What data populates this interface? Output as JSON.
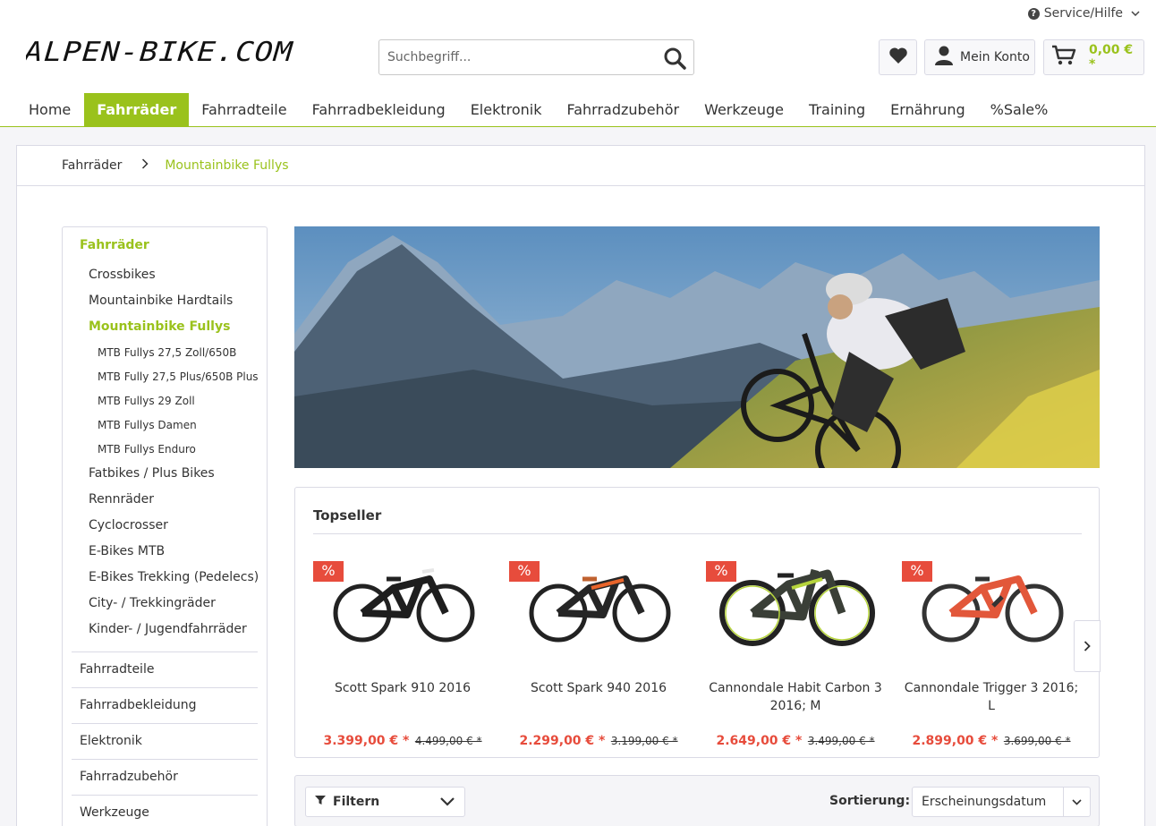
{
  "header": {
    "service_label": "Service/Hilfe",
    "logo_text": "ALPEN-BIKE.COM",
    "search_placeholder": "Suchbegriff...",
    "account_label": "Mein Konto",
    "cart_total": "0,00 € *"
  },
  "nav": {
    "items": [
      "Home",
      "Fahrräder",
      "Fahrradteile",
      "Fahrradbekleidung",
      "Elektronik",
      "Fahrradzubehör",
      "Werkzeuge",
      "Training",
      "Ernährung",
      "%Sale%"
    ],
    "active": "Fahrräder"
  },
  "breadcrumb": {
    "items": [
      "Fahrräder",
      "Mountainbike Fullys"
    ]
  },
  "sidebar": {
    "heading": "Fahrräder",
    "items": [
      {
        "label": "Crossbikes"
      },
      {
        "label": "Mountainbike Hardtails"
      },
      {
        "label": "Mountainbike Fullys",
        "active": true
      },
      {
        "label": "MTB Fullys 27,5 Zoll/650B",
        "sub": true
      },
      {
        "label": "MTB Fully 27,5 Plus/650B Plus",
        "sub": true
      },
      {
        "label": "MTB Fullys 29 Zoll",
        "sub": true
      },
      {
        "label": "MTB Fullys Damen",
        "sub": true
      },
      {
        "label": "MTB Fullys Enduro",
        "sub": true
      },
      {
        "label": "Fatbikes / Plus Bikes"
      },
      {
        "label": "Rennräder"
      },
      {
        "label": "Cyclocrosser"
      },
      {
        "label": "E-Bikes MTB"
      },
      {
        "label": "E-Bikes Trekking (Pedelecs)"
      },
      {
        "label": "City- / Trekkingräder"
      },
      {
        "label": "Kinder- / Jugendfahrräder"
      }
    ],
    "main_categories": [
      "Fahrradteile",
      "Fahrradbekleidung",
      "Elektronik",
      "Fahrradzubehör",
      "Werkzeuge"
    ]
  },
  "topseller": {
    "title": "Topseller",
    "badge": "%",
    "products": [
      {
        "name": "Scott Spark 910 2016",
        "price": "3.399,00 € *",
        "old_price": "4.499,00 € *",
        "frame_color": "#1e1e1e",
        "accent": "#e6e6e6"
      },
      {
        "name": "Scott Spark 940 2016",
        "price": "2.299,00 € *",
        "old_price": "3.199,00 € *",
        "frame_color": "#262626",
        "accent": "#e8642a"
      },
      {
        "name": "Cannondale Habit Carbon 3 2016; M",
        "price": "2.649,00 € *",
        "old_price": "3.499,00 € *",
        "frame_color": "#3a3f37",
        "accent": "#b6d43c"
      },
      {
        "name": "Cannondale Trigger 3 2016; L",
        "price": "2.899,00 € *",
        "old_price": "3.699,00 € *",
        "frame_color": "#e2573a",
        "accent": "#333333"
      }
    ]
  },
  "filter": {
    "button_label": "Filtern",
    "sort_label": "Sortierung:",
    "sort_value": "Erscheinungsdatum"
  },
  "colors": {
    "accent": "#9ac21c",
    "sale": "#e74c3c"
  }
}
